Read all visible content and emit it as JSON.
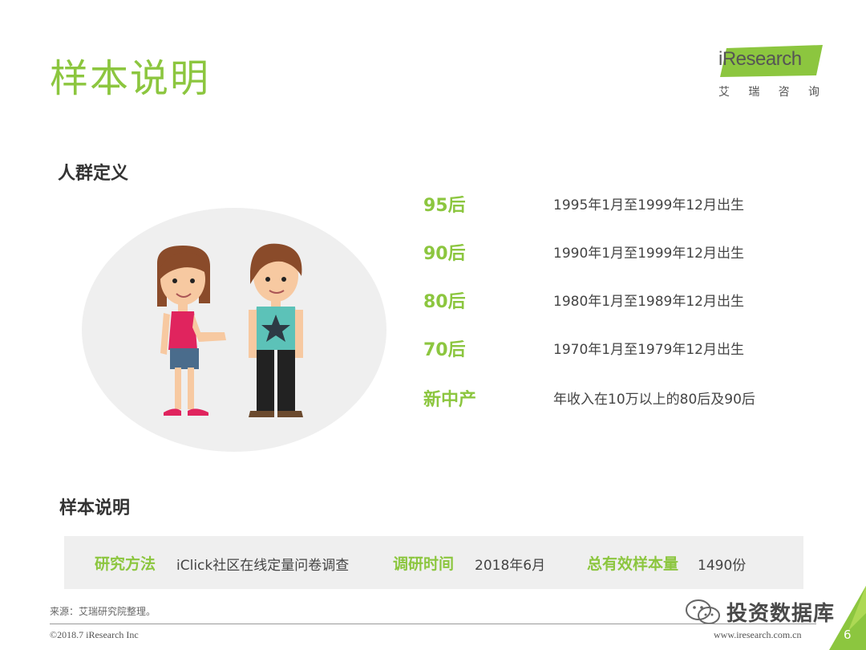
{
  "header": {
    "title": "样本说明",
    "logo": {
      "brand": "iResearch",
      "subtitle": [
        "艾",
        "瑞",
        "咨",
        "询"
      ]
    }
  },
  "population": {
    "heading": "人群定义",
    "definitions": [
      {
        "label": "95后",
        "description": "1995年1月至1999年12月出生"
      },
      {
        "label": "90后",
        "description": "1990年1月至1999年12月出生"
      },
      {
        "label": "80后",
        "description": "1980年1月至1989年12月出生"
      },
      {
        "label": "70后",
        "description": "1970年1月至1979年12月出生"
      },
      {
        "label": "新中产",
        "description": "年收入在10万以上的80后及90后"
      }
    ]
  },
  "sample": {
    "heading": "样本说明",
    "method_label": "研究方法",
    "method_value": "iClick社区在线定量问卷调查",
    "time_label": "调研时间",
    "time_value": "2018年6月",
    "size_label": "总有效样本量",
    "size_value": "1490份"
  },
  "footer": {
    "source": "来源：艾瑞研究院整理。",
    "copyright": "©2018.7 iResearch Inc",
    "url": "www.iresearch.com.cn",
    "page_number": "6"
  },
  "watermark": {
    "text": "投资数据库"
  },
  "colors": {
    "accent": "#8cc63f",
    "sample_bar": "#efefef",
    "corner": "#8cc63f"
  }
}
